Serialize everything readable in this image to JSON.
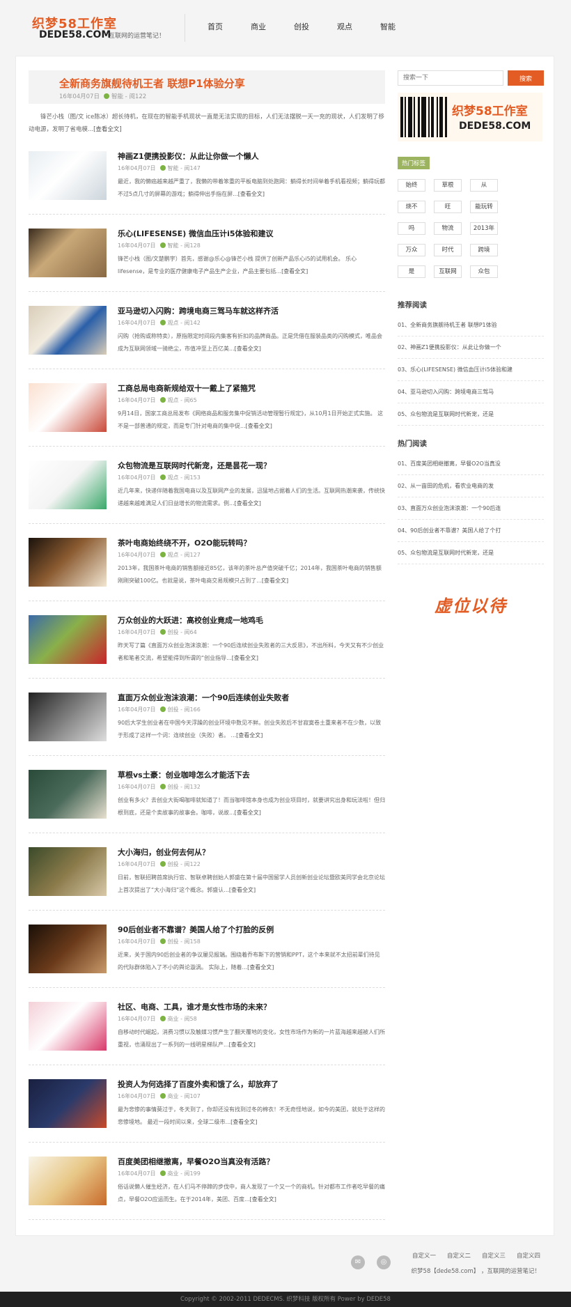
{
  "header": {
    "logo_top": "织梦58工作室",
    "logo_bottom": "DEDE58.COM",
    "slogan": "互联网的运营笔记！",
    "nav": [
      "首页",
      "商业",
      "创投",
      "观点",
      "智能"
    ]
  },
  "featured": {
    "title": "全新商务旗舰待机王者 联想P1体验分享",
    "date": "16年04月07日",
    "category": "智能",
    "views": "阅122",
    "intro": "锋芒小栈（图/文 ice陈冰）超长待机，在现在的智能手机现状一直是无法实现的目标，人们无法摆脱一天一充的现状，人们发明了移动电源，发明了省电模...",
    "more": "[查看全文]"
  },
  "articles": [
    {
      "title": "神画Z1便携投影仪：从此让你做一个懒人",
      "date": "16年04月07日",
      "category": "智能",
      "views": "阅147",
      "desc": "最近，我的懒癌越来越严重了，我懒的带着笨重的平板电脑到处跑网：躺得长时间举着手机看视频；躺得玩都不过5点几寸的屏幕的游戏；躺得伸出手指在屏...",
      "more": "[查看全文]"
    },
    {
      "title": "乐心(LIFESENSE) 微信血压计i5体验和建议",
      "date": "16年04月07日",
      "category": "智能",
      "views": "阅128",
      "desc": "锋芒小栈（图/文楚鹏宇）首先，感谢@乐心@锋芒小栈 提供了创新产品乐心i5的试用机会。 乐心lifesense，是专业的医疗健康电子产品生产企业，产品主要包括...",
      "more": "[查看全文]"
    },
    {
      "title": "亚马逊切入闪购：跨境电商三驾马车就这样齐活",
      "date": "16年04月07日",
      "category": "观点",
      "views": "阅142",
      "desc": "闪购（抢购或称特卖），原指限定时间段内集客有折扣的品牌商品。正是凭借在服装品类的闪购模式，唯品会成为互联网领域一骑绝尘，市值冲至上百亿美...",
      "more": "[查看全文]"
    },
    {
      "title": "工商总局电商新规给双十一戴上了紧箍咒",
      "date": "16年04月07日",
      "category": "观点",
      "views": "阅65",
      "desc": "9月14日，国家工商总局发布《网络商品和服务集中促销活动管理暂行规定》，从10月1日开始正式实施。 这不是一部普通的规定，而是专门针对电商的集中促...",
      "more": "[查看全文]"
    },
    {
      "title": "众包物流是互联网时代新宠，还是昙花一现？",
      "date": "16年04月07日",
      "category": "观点",
      "views": "阅153",
      "desc": "近几年来，快递伴随着我国电商以及互联网产业的发展，迅猛地占据着人们的生活。互联网热潮来袭，传统快递越来越难满足人们日益增长的物流需求。例...",
      "more": "[查看全文]"
    },
    {
      "title": "茶叶电商始终绕不开，O2O能玩转吗？",
      "date": "16年04月07日",
      "category": "观点",
      "views": "阅127",
      "desc": "2013年，我国茶叶电商的销售额接近85亿，该年的茶叶总产值突破千亿；2014年，我国茶叶电商的销售额刚刚突破100亿。也就是说，茶叶电商交易规模只占到了...",
      "more": "[查看全文]"
    },
    {
      "title": "万众创业的大跃进：高校创业竟成一地鸡毛",
      "date": "16年04月07日",
      "category": "创投",
      "views": "阅64",
      "desc": "昨天写了篇《直面万众创业泡沫浪潮：一个90后连续创业失败者的三大反思》，不出所料，今天又有不少创业者和笔者交流，希望能得到所谓的“创业指导...",
      "more": "[查看全文]"
    },
    {
      "title": "直面万众创业泡沫浪潮：一个90后连续创业失败者",
      "date": "16年04月07日",
      "category": "创投",
      "views": "阅166",
      "desc": "90后大学生创业者在中国今天浮躁的创业环境中数见不鲜。创业失败后不甘寂寞卷土重来者不在少数，以致于形成了这样一个词：连续创业（失败）者。 ...",
      "more": "[查看全文]"
    },
    {
      "title": "草根vs土豪：创业咖啡怎么才能活下去",
      "date": "16年04月07日",
      "category": "创投",
      "views": "阅132",
      "desc": "创业有多火？去创业大街喝咖啡就知道了！而当咖啡馆本身也成为创业项目时，就要讲究出身和玩法啦！但归根到底，还是个卖故事的故事会。咖啡，说故...",
      "more": "[查看全文]"
    },
    {
      "title": "大小海归，创业何去何从？",
      "date": "16年04月07日",
      "category": "创投",
      "views": "阅122",
      "desc": "日前，智联招聘首席执行官、智联卓聘创始人郭盛在第十届中国留学人员创新创业论坛暨欧美同学会北京论坛上首次提出了“大小海归”这个概念。郭盛认...",
      "more": "[查看全文]"
    },
    {
      "title": "90后创业者不靠谱？美国人给了个打脸的反例",
      "date": "16年04月07日",
      "category": "创投",
      "views": "阅158",
      "desc": "近来，关于国内90后创业者的争议屡见报端。围绕着乔布斯下的营销和PPT，这个本来就不太招前辈们待见的代际群体陷入了不小的舆论漩涡。 实际上，随着...",
      "more": "[查看全文]"
    },
    {
      "title": "社区、电商、工具，谁才是女性市场的未来？",
      "date": "16年04月07日",
      "category": "商业",
      "views": "阅58",
      "desc": "自移动时代崛起，消费习惯以及触媒习惯产生了翻天覆地的变化，女性市场作为新的一片蓝海越来越被人们所重视，也涌现出了一系列的一线明星梯队产...",
      "more": "[查看全文]"
    },
    {
      "title": "投资人为何选择了百度外卖和饿了么，却放弃了",
      "date": "16年04月07日",
      "category": "商业",
      "views": "阅107",
      "desc": "最为悲惨的事情莫过于，冬天到了，你却还没有找到过冬的棉衣！不无奇怪地说，如今的美团，就处于这样的悲惨境地。 最近一段时间以来，全球二级市...",
      "more": "[查看全文]"
    },
    {
      "title": "百度美团相继撤离，早餐O2O当真没有活路？",
      "date": "16年04月07日",
      "category": "商业",
      "views": "阅199",
      "desc": "俗话说懒人催生经济，在人们马不停蹄的步伐中，商人发现了一个又一个的商机。针对都市工作者吃早餐的痛点，早餐O2O应运而生。在于2014年，美团、百度...",
      "more": "[查看全文]"
    }
  ],
  "sidebar": {
    "search_placeholder": "搜索一下",
    "search_button": "搜索",
    "promo_t1": "织梦58工作室",
    "promo_t2": "DEDE58.COM",
    "tags_heading": "热门标签",
    "tags": [
      "始终",
      "草根",
      "从",
      "烧不",
      "旺",
      "能玩转",
      "吗",
      "物流",
      "2013年",
      "万众",
      "时代",
      "跨境",
      "是",
      "互联网",
      "众包"
    ],
    "recommended_heading": "推荐阅读",
    "recommended": [
      "01、全新商务旗舰待机王者 联想P1体验",
      "02、神画Z1便携投影仪：从此让你做一个",
      "03、乐心(LIFESENSE) 微信血压计i5体验和建",
      "04、亚马逊切入闪购：跨境电商三驾马",
      "05、众包物流是互联网时代新宠，还是"
    ],
    "hot_heading": "热门阅读",
    "hot": [
      "01、百度美团相继撤离，早餐O2O当真没",
      "02、从一亩田的危机，看农业电商的发",
      "03、直面万众创业泡沫浪潮：一个90后连",
      "04、90后创业者不靠谱？美国人给了个打",
      "05、众包物流是互联网时代新宠，还是"
    ],
    "welcome": "虚位以待"
  },
  "footer": {
    "links": [
      "自定义一",
      "自定义二",
      "自定义三",
      "自定义四"
    ],
    "copyline": "织梦58【dede58.com】 ，互联网的运营笔记！",
    "copyright": "Copyright © 2002-2011 DEDECMS. 织梦科技 版权所有 Power by DEDE58"
  },
  "colors": {
    "accent": "#e25c24",
    "tag_green": "#9cb35f"
  }
}
